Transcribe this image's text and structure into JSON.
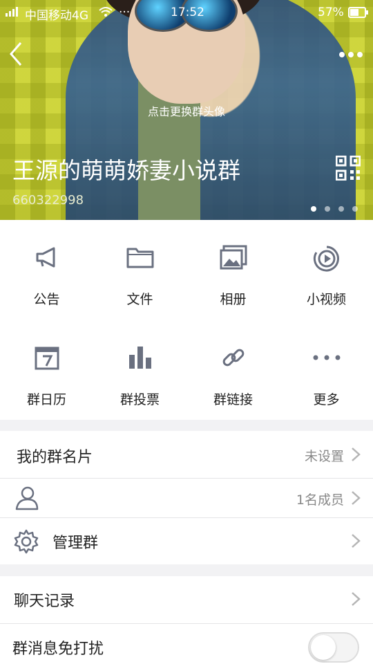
{
  "status_bar": {
    "carrier": "中国移动4G",
    "time": "17:52",
    "battery": "57%"
  },
  "header": {
    "change_avatar_hint": "点击更换群头像",
    "group_name": "王源的萌萌娇妻小说群",
    "group_id": "660322998",
    "page_indicator_count": 4
  },
  "quick_actions": [
    {
      "label": "公告",
      "icon": "megaphone-icon"
    },
    {
      "label": "文件",
      "icon": "folder-icon"
    },
    {
      "label": "相册",
      "icon": "album-icon"
    },
    {
      "label": "小视频",
      "icon": "video-icon"
    },
    {
      "label": "群日历",
      "icon": "calendar-icon"
    },
    {
      "label": "群投票",
      "icon": "bar-chart-icon"
    },
    {
      "label": "群链接",
      "icon": "link-icon"
    },
    {
      "label": "更多",
      "icon": "more-icon"
    }
  ],
  "settings": {
    "card_title": "我的群名片",
    "card_value": "未设置",
    "members_value": "1名成员",
    "manage_title": "管理群",
    "chat_history": "聊天记录",
    "mute_title": "群消息免打扰",
    "mute_enabled": false
  }
}
